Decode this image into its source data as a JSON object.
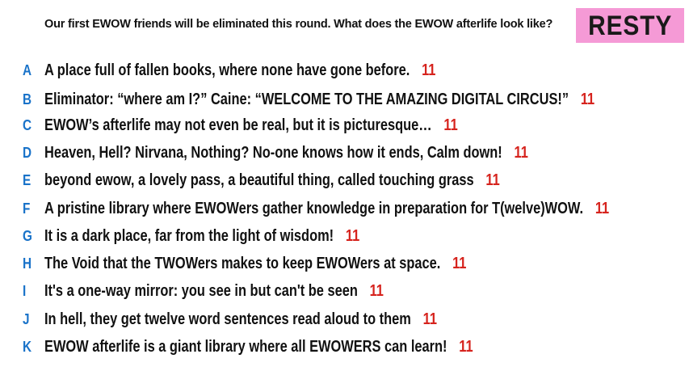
{
  "prompt": "Our first EWOW friends will be eliminated this round. What does the EWOW afterlife look like?",
  "contestant_name": "RESTY",
  "colors": {
    "badge_background": "#f59ad6",
    "letter_color": "#1a73c9",
    "score_color": "#d6231d"
  },
  "responses": [
    {
      "letter": "A",
      "text": "A place full of fallen books, where none have gone before.",
      "score": "11"
    },
    {
      "letter": "B",
      "text": "Eliminator: “where am I?” Caine: “WELCOME TO THE AMAZING DIGITAL CIRCUS!”",
      "score": "11"
    },
    {
      "letter": "C",
      "text": "EWOW’s afterlife may not even be real, but it is picturesque…",
      "score": "11"
    },
    {
      "letter": "D",
      "text": "Heaven, Hell? Nirvana, Nothing? No-one knows how it ends, Calm down!",
      "score": "11"
    },
    {
      "letter": "E",
      "text": "beyond ewow, a lovely pass, a beautiful thing, called touching grass",
      "score": "11"
    },
    {
      "letter": "F",
      "text": "A pristine library where EWOWers gather knowledge in preparation for T(welve)WOW.",
      "score": "11"
    },
    {
      "letter": "G",
      "text": "It is a dark place, far from the light of wisdom!",
      "score": "11"
    },
    {
      "letter": "H",
      "text": "The Void that the TWOWers makes to keep EWOWers at space.",
      "score": "11"
    },
    {
      "letter": "I",
      "text": "It's a one-way mirror: you see in but can't be seen",
      "score": "11"
    },
    {
      "letter": "J",
      "text": "In hell, they get twelve word sentences read aloud to them",
      "score": "11"
    },
    {
      "letter": "K",
      "text": "EWOW afterlife is a giant library where all EWOWERS can learn!",
      "score": "11"
    }
  ]
}
